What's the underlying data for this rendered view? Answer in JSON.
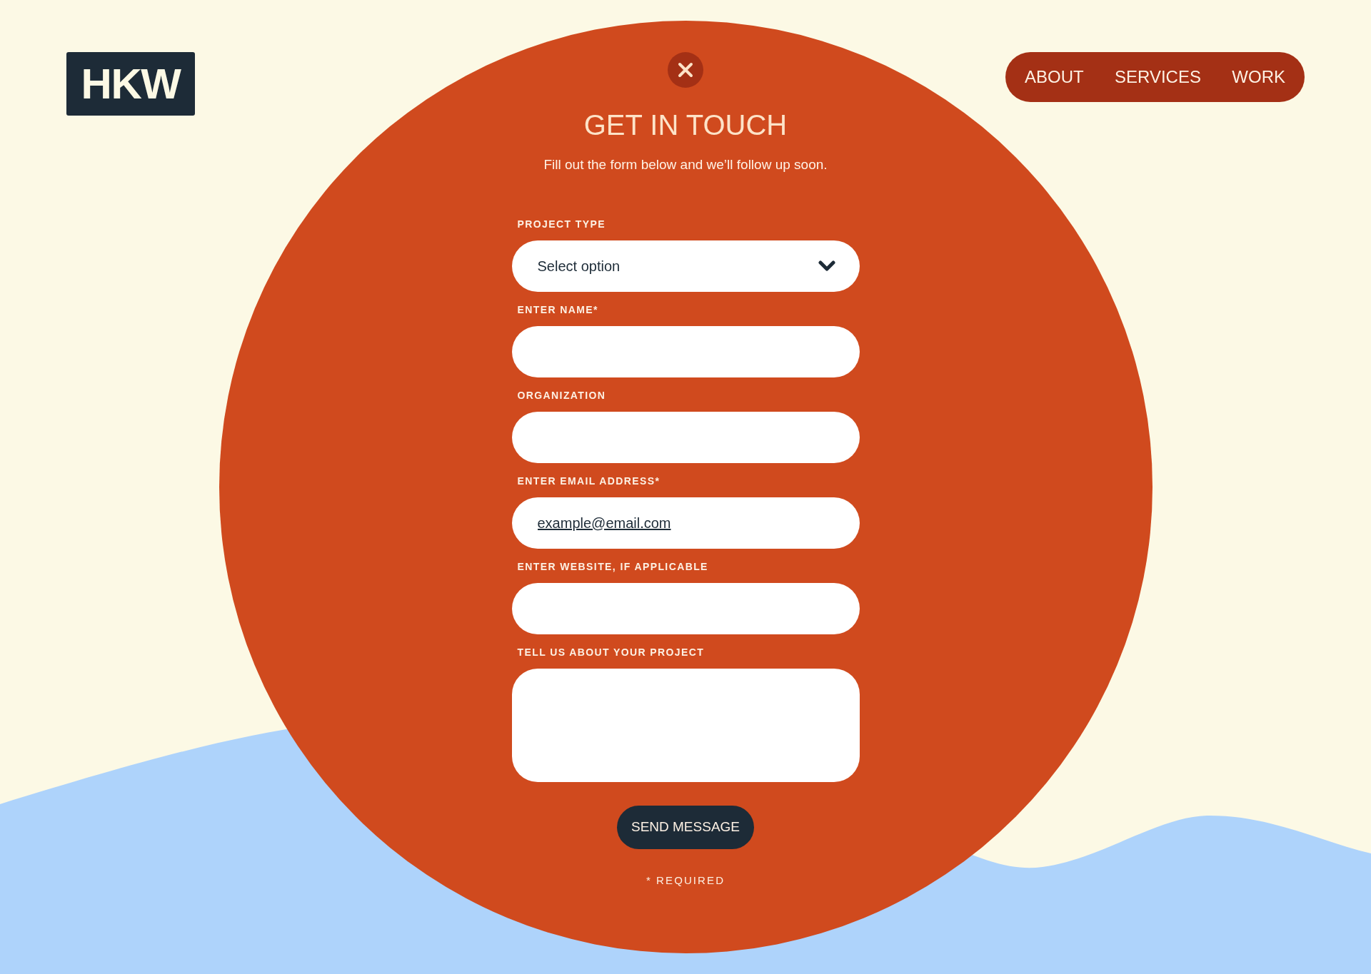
{
  "header": {
    "logo": {
      "text": "HKW"
    },
    "nav": [
      {
        "label": "ABOUT"
      },
      {
        "label": "SERVICES"
      },
      {
        "label": "WORK"
      }
    ]
  },
  "dialog": {
    "title": "GET IN TOUCH",
    "subtitle": "Fill out the form below and we’ll follow up soon.",
    "fields": [
      {
        "kind": "select",
        "label": "PROJECT TYPE",
        "value": "Select option"
      },
      {
        "kind": "text",
        "label": "ENTER NAME*"
      },
      {
        "kind": "text",
        "label": "ORGANIZATION"
      },
      {
        "kind": "text",
        "label": "ENTER EMAIL ADDRESS*",
        "value": "example@email.com"
      },
      {
        "kind": "text",
        "label": "ENTER WEBSITE, IF APPLICABLE"
      },
      {
        "kind": "textarea",
        "label": "TELL US ABOUT YOUR PROJECT"
      }
    ],
    "submit": "SEND MESSAGE",
    "note": "* REQUIRED"
  }
}
